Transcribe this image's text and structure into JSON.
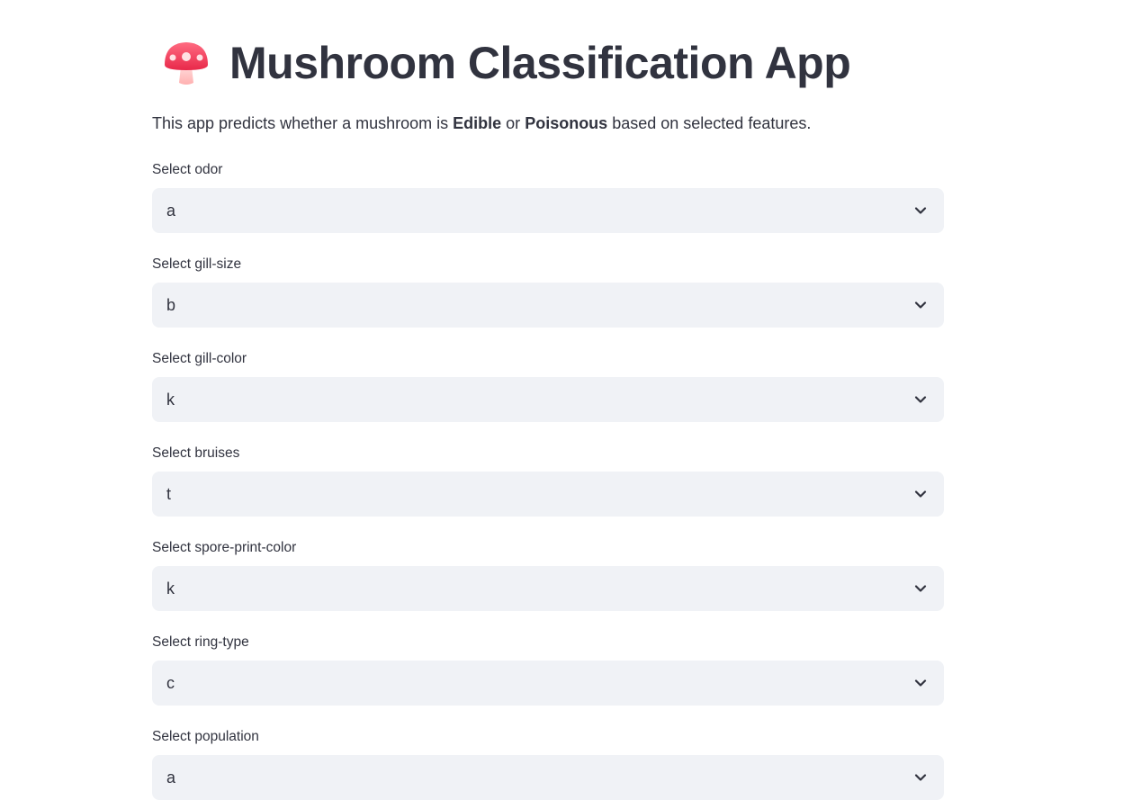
{
  "header": {
    "icon": "mushroom-icon",
    "title": "Mushroom Classification App"
  },
  "description": {
    "prefix": "This app predicts whether a mushroom is ",
    "edible": "Edible",
    "middle": " or ",
    "poisonous": "Poisonous",
    "suffix": " based on selected features."
  },
  "fields": [
    {
      "label": "Select odor",
      "value": "a"
    },
    {
      "label": "Select gill-size",
      "value": "b"
    },
    {
      "label": "Select gill-color",
      "value": "k"
    },
    {
      "label": "Select bruises",
      "value": "t"
    },
    {
      "label": "Select spore-print-color",
      "value": "k"
    },
    {
      "label": "Select ring-type",
      "value": "c"
    },
    {
      "label": "Select population",
      "value": "a"
    }
  ],
  "colors": {
    "text": "#31333f",
    "select_bg": "#f0f2f6",
    "mushroom_cap": "#f0435e",
    "mushroom_stem": "#ffc9c9"
  }
}
